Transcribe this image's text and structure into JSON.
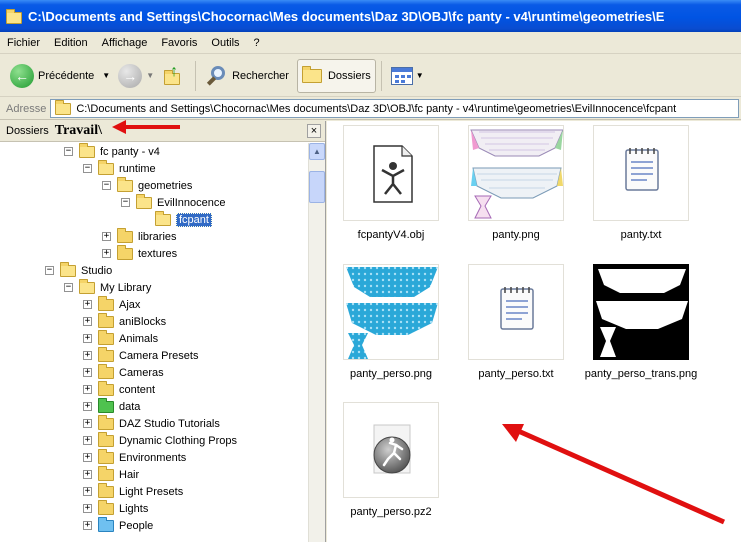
{
  "window": {
    "title": "C:\\Documents and Settings\\Chocornac\\Mes documents\\Daz 3D\\OBJ\\fc panty - v4\\runtime\\geometries\\E"
  },
  "menu": [
    "Fichier",
    "Edition",
    "Affichage",
    "Favoris",
    "Outils",
    "?"
  ],
  "toolbar": {
    "back_label": "Précédente",
    "search_label": "Rechercher",
    "folders_label": "Dossiers"
  },
  "address": {
    "label": "Adresse",
    "value": "C:\\Documents and Settings\\Chocornac\\Mes documents\\Daz 3D\\OBJ\\fc panty - v4\\runtime\\geometries\\EvilInnocence\\fcpant"
  },
  "folders_pane": {
    "title": "Dossiers",
    "annotation": "Travail\\",
    "close_glyph": "×"
  },
  "tree": [
    {
      "label": "fc panty - v4",
      "expander": "−",
      "folder": "open"
    },
    {
      "label": "runtime",
      "expander": "−",
      "folder": "open"
    },
    {
      "label": "geometries",
      "expander": "−",
      "folder": "open"
    },
    {
      "label": "EvilInnocence",
      "expander": "−",
      "folder": "open"
    },
    {
      "label": "fcpant",
      "expander": "",
      "folder": "open",
      "selected": true
    },
    {
      "label": "libraries",
      "expander": "+",
      "folder": "yellow"
    },
    {
      "label": "textures",
      "expander": "+",
      "folder": "yellow"
    },
    {
      "label": "Studio",
      "expander": "−",
      "folder": "open"
    },
    {
      "label": "My Library",
      "expander": "−",
      "folder": "open"
    },
    {
      "label": "Ajax",
      "expander": "+",
      "folder": "yellow"
    },
    {
      "label": "aniBlocks",
      "expander": "+",
      "folder": "yellow"
    },
    {
      "label": "Animals",
      "expander": "+",
      "folder": "yellow"
    },
    {
      "label": "Camera Presets",
      "expander": "+",
      "folder": "yellow"
    },
    {
      "label": "Cameras",
      "expander": "+",
      "folder": "yellow"
    },
    {
      "label": "content",
      "expander": "+",
      "folder": "yellow"
    },
    {
      "label": "data",
      "expander": "+",
      "folder": "green"
    },
    {
      "label": "DAZ Studio Tutorials",
      "expander": "+",
      "folder": "yellow"
    },
    {
      "label": "Dynamic Clothing Props",
      "expander": "+",
      "folder": "yellow"
    },
    {
      "label": "Environments",
      "expander": "+",
      "folder": "yellow"
    },
    {
      "label": "Hair",
      "expander": "+",
      "folder": "yellow"
    },
    {
      "label": "Light Presets",
      "expander": "+",
      "folder": "yellow"
    },
    {
      "label": "Lights",
      "expander": "+",
      "folder": "yellow"
    },
    {
      "label": "People",
      "expander": "+",
      "folder": "blue"
    }
  ],
  "files": [
    {
      "name": "fcpantyV4.obj",
      "icon": "obj-file-icon"
    },
    {
      "name": "panty.png",
      "icon": "uv-map-thumbnail"
    },
    {
      "name": "panty.txt",
      "icon": "text-file-icon"
    },
    {
      "name": "panty_perso.png",
      "icon": "blue-texture-thumbnail"
    },
    {
      "name": "panty_perso.txt",
      "icon": "text-file-icon"
    },
    {
      "name": "panty_perso_trans.png",
      "icon": "transparency-map-thumbnail"
    },
    {
      "name": "panty_perso.pz2",
      "icon": "pz2-file-icon"
    }
  ],
  "colors": {
    "title_bar": "#0054e3",
    "selection": "#316ac5",
    "annotation_arrow": "#e01010",
    "texture_blue": "#2aa8d8"
  }
}
